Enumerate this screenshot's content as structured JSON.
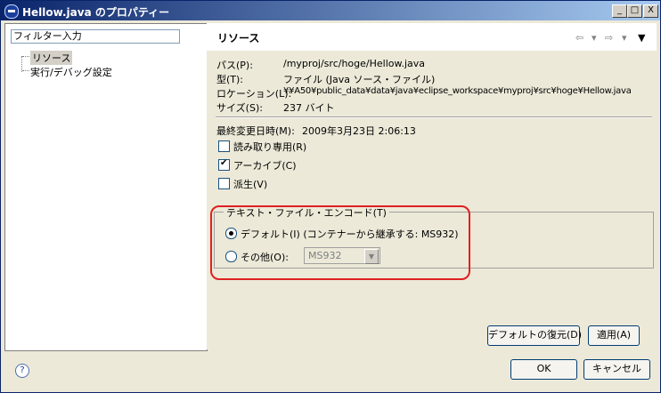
{
  "window": {
    "title": "Hellow.java のプロパティー",
    "controls": [
      "_",
      "□",
      "X"
    ]
  },
  "left": {
    "filter_placeholder": "フィルター入力",
    "tree_items": [
      "リソース",
      "実行/デバッグ設定"
    ]
  },
  "right": {
    "title": "リソース",
    "nav": {
      "back": "⇦",
      "back_menu": "▾",
      "forward": "⇨",
      "forward_menu": "▾",
      "view_menu": "▼"
    },
    "props": {
      "path_label": "パス(P):",
      "path_value": "/myproj/src/hoge/Hellow.java",
      "type_label": "型(T):",
      "type_value": "ファイル (Java ソース・ファイル)",
      "location_label": "ロケーション(L):",
      "location_value": "¥¥A50¥public_data¥data¥java¥eclipse_workspace¥myproj¥src¥hoge¥Hellow.java",
      "size_label": "サイズ(S):",
      "size_value": "237 バイト",
      "modified_label": "最終変更日時(M):",
      "modified_value": "2009年3月23日 2:06:13"
    },
    "checkboxes": {
      "readonly": "読み取り専用(R)",
      "archive": "アーカイブ(C)",
      "derived": "派生(V)"
    },
    "encoding": {
      "group_label": "テキスト・ファイル・エンコード(T)",
      "default_label": "デフォルト(I) (コンテナーから継承する: MS932)",
      "other_label": "その他(O):",
      "other_value": "MS932"
    },
    "restore_button": "デフォルトの復元(D)",
    "apply_button": "適用(A)"
  },
  "footer": {
    "help": "?",
    "ok_button": "OK",
    "cancel_button": "キャンセル"
  }
}
